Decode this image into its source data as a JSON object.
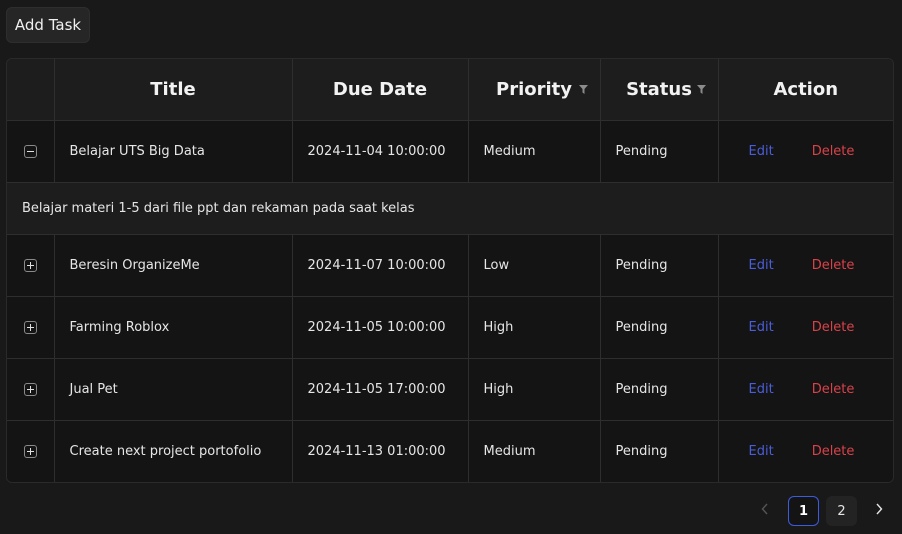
{
  "toolbar": {
    "add_task_label": "Add Task"
  },
  "table": {
    "headers": {
      "title": "Title",
      "due_date": "Due Date",
      "priority": "Priority",
      "status": "Status",
      "action": "Action"
    },
    "rows": [
      {
        "title": "Belajar UTS Big Data",
        "due_date": "2024-11-04 10:00:00",
        "priority": "Medium",
        "status": "Pending",
        "edit": "Edit",
        "delete": "Delete",
        "expanded": true,
        "description": "Belajar materi 1-5 dari file ppt dan rekaman pada saat kelas"
      },
      {
        "title": "Beresin OrganizeMe",
        "due_date": "2024-11-07 10:00:00",
        "priority": "Low",
        "status": "Pending",
        "edit": "Edit",
        "delete": "Delete",
        "expanded": false
      },
      {
        "title": "Farming Roblox",
        "due_date": "2024-11-05 10:00:00",
        "priority": "High",
        "status": "Pending",
        "edit": "Edit",
        "delete": "Delete",
        "expanded": false
      },
      {
        "title": "Jual Pet",
        "due_date": "2024-11-05 17:00:00",
        "priority": "High",
        "status": "Pending",
        "edit": "Edit",
        "delete": "Delete",
        "expanded": false
      },
      {
        "title": "Create next project portofolio",
        "due_date": "2024-11-13 01:00:00",
        "priority": "Medium",
        "status": "Pending",
        "edit": "Edit",
        "delete": "Delete",
        "expanded": false
      }
    ]
  },
  "pagination": {
    "prev_icon": "chevron-left-icon",
    "next_icon": "chevron-right-icon",
    "pages": [
      "1",
      "2"
    ],
    "current_page": "1"
  },
  "colors": {
    "background": "#191919",
    "edit_link": "#4a5ed9",
    "delete_link": "#d9424a",
    "active_page_border": "#3c5ce0"
  }
}
